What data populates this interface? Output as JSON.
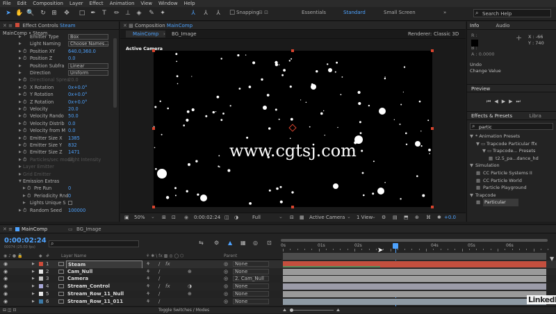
{
  "menu": [
    "File",
    "Edit",
    "Composition",
    "Layer",
    "Effect",
    "Animation",
    "View",
    "Window",
    "Help"
  ],
  "toolbar": {
    "snapping": "Snapping",
    "workspaces": [
      "Essentials",
      "Standard",
      "Small Screen"
    ],
    "active_workspace": "Standard",
    "search_placeholder": "Search Help"
  },
  "effect_controls": {
    "tab_title": "Effect Controls",
    "tab_layer": "Steam",
    "breadcrumb": "MainComp • Steam",
    "properties": [
      {
        "name": "Emitter Type",
        "value": "Box",
        "kind": "dropdown",
        "dim": false
      },
      {
        "name": "Light Naming",
        "value": "Choose Names...",
        "kind": "dropdown",
        "dim": false
      },
      {
        "name": "Position XY",
        "value": "640.0,360.0",
        "kind": "value",
        "dim": false
      },
      {
        "name": "Position Z",
        "value": "0.0",
        "kind": "value",
        "dim": false
      },
      {
        "name": "Position Subfra",
        "value": "Linear",
        "kind": "dropdown",
        "dim": false
      },
      {
        "name": "Direction",
        "value": "Uniform",
        "kind": "dropdown",
        "dim": false
      },
      {
        "name": "Directional Sprea",
        "value": "20.0",
        "kind": "value",
        "dim": true
      },
      {
        "name": "X Rotation",
        "value": "0x+0.0°",
        "kind": "value",
        "dim": false
      },
      {
        "name": "Y Rotation",
        "value": "0x+0.0°",
        "kind": "value",
        "dim": false
      },
      {
        "name": "Z Rotation",
        "value": "0x+0.0°",
        "kind": "value",
        "dim": false
      },
      {
        "name": "Velocity",
        "value": "20.0",
        "kind": "value",
        "dim": false
      },
      {
        "name": "Velocity Rando",
        "value": "50.0",
        "kind": "value",
        "dim": false
      },
      {
        "name": "Velocity Distrib",
        "value": "0.0",
        "kind": "value",
        "dim": false
      },
      {
        "name": "Velocity from M",
        "value": "0.0",
        "kind": "value",
        "dim": false
      },
      {
        "name": "Emitter Size X",
        "value": "1385",
        "kind": "value",
        "dim": false
      },
      {
        "name": "Emitter Size Y",
        "value": "832",
        "kind": "value",
        "dim": false
      },
      {
        "name": "Emitter Size Z",
        "value": "1471",
        "kind": "value",
        "dim": false
      },
      {
        "name": "Particles/sec modif",
        "value": "Light Intensity",
        "kind": "value",
        "dim": true
      },
      {
        "name": "Layer Emitter",
        "value": "",
        "kind": "group",
        "dim": true
      },
      {
        "name": "Grid Emitter",
        "value": "",
        "kind": "group",
        "dim": true
      },
      {
        "name": "Emission Extras",
        "value": "",
        "kind": "group-open",
        "dim": false
      },
      {
        "name": "Pre Run",
        "value": "0",
        "kind": "sub",
        "dim": false
      },
      {
        "name": "Periodicity Rnd",
        "value": "0",
        "kind": "sub",
        "dim": false
      },
      {
        "name": "Lights Unique S",
        "value": "",
        "kind": "check",
        "dim": false
      },
      {
        "name": "Random Seed",
        "value": "100000",
        "kind": "value",
        "dim": false
      }
    ]
  },
  "composition": {
    "tab_title": "Composition",
    "tab_name": "MainComp",
    "sub_tabs": [
      "MainComp",
      "BG_Image"
    ],
    "renderer_label": "Renderer:",
    "renderer": "Classic 3D",
    "view_label": "Active Camera",
    "watermark": "www.cgtsj.com",
    "zoom": "50%",
    "timecode": "0:00:02:24",
    "resolution": "Full",
    "camera": "Active Camera",
    "views": "1 View",
    "exposure": "+0.0"
  },
  "info": {
    "tab": "Info",
    "tab2": "Audio",
    "r": "R :",
    "g": "G :",
    "b": "B :",
    "a": "A : 0.0000",
    "x": "X : -66",
    "y": "Y : 740",
    "undo": "Undo",
    "undo_action": "Change Value"
  },
  "preview": {
    "tab": "Preview"
  },
  "effects_presets": {
    "tab": "Effects & Presets",
    "tab2": "Libra",
    "search": "partic",
    "tree": [
      {
        "label": "* Animation Presets",
        "level": 0
      },
      {
        "label": "Trapcode Particular ffx",
        "level": 1
      },
      {
        "label": "Trapcode... Presets",
        "level": 2
      },
      {
        "label": "t2.5_pa...dance_hd",
        "level": 3
      },
      {
        "label": "Simulation",
        "level": 0
      },
      {
        "label": "CC Particle Systems II",
        "level": 1
      },
      {
        "label": "CC Particle World",
        "level": 1
      },
      {
        "label": "Particle Playground",
        "level": 1
      },
      {
        "label": "Trapcode",
        "level": 0
      },
      {
        "label": "Particular",
        "level": 1
      }
    ]
  },
  "timeline": {
    "tabs": [
      "MainComp",
      "BG_Image"
    ],
    "timecode": "0:00:02:24",
    "frame_info": "00074 (25.00 fps)",
    "search_placeholder": "",
    "header_num": "#",
    "header_name": "Layer Name",
    "header_parent": "Parent",
    "ruler": [
      "0s",
      "01s",
      "02s",
      "04s",
      "05s",
      "06s"
    ],
    "layers": [
      {
        "num": "1",
        "name": "Steam",
        "color": "#d04c3a",
        "parent": "None",
        "bar": "#c44f3e",
        "selected": true
      },
      {
        "num": "2",
        "name": "Cam_Null",
        "color": "#e8e8e8",
        "parent": "None",
        "bar": "#9a9a9a",
        "selected": false
      },
      {
        "num": "3",
        "name": "Camera",
        "color": "#c8c8c8",
        "parent": "2. Cam_Null",
        "bar": "#a0a0a0",
        "selected": false
      },
      {
        "num": "4",
        "name": "Stream_Control",
        "color": "#a8a8d8",
        "parent": "None",
        "bar": "#9b9ba8",
        "selected": false
      },
      {
        "num": "5",
        "name": "Stream_Row_11_Null",
        "color": "#e8e8e8",
        "parent": "None",
        "bar": "#9a9a9a",
        "selected": false
      },
      {
        "num": "6",
        "name": "Stream_Row_11_011",
        "color": "#3c7aa8",
        "parent": "None",
        "bar": "#8e9aa4",
        "selected": false
      }
    ],
    "toggle": "Toggle Switches / Modes"
  },
  "brand": "LinkedIn",
  "colors": {
    "accent": "#2d8ceb",
    "value_blue": "#4ea3ff",
    "label_red": "#d04c3a"
  }
}
